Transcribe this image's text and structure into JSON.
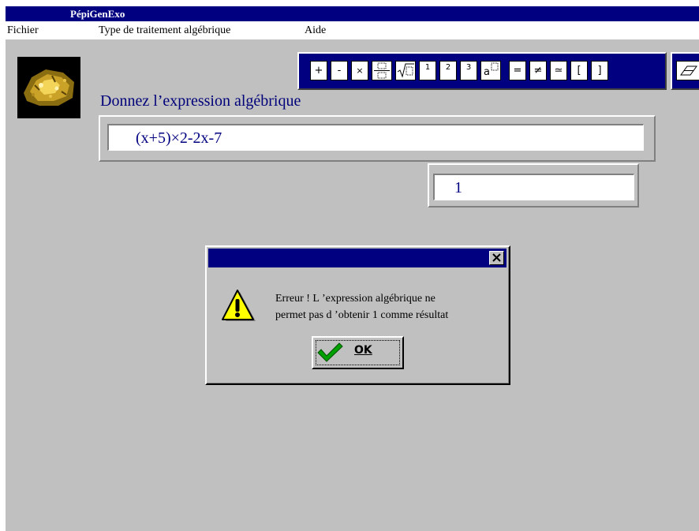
{
  "window": {
    "title": "PépiGenExo"
  },
  "menu": {
    "items": [
      "Fichier",
      "Type de traitement algébrique",
      "Aide"
    ]
  },
  "toolbar": {
    "buttons": [
      {
        "icon": "plus-icon",
        "label": "+"
      },
      {
        "icon": "minus-icon",
        "label": "-"
      },
      {
        "icon": "times-icon",
        "label": "×"
      },
      {
        "icon": "fraction-icon",
        "label": ""
      },
      {
        "icon": "sqrt-icon",
        "label": ""
      },
      {
        "icon": "superscript-1-icon",
        "label": "1"
      },
      {
        "icon": "superscript-2-icon",
        "label": "2"
      },
      {
        "icon": "superscript-3-icon",
        "label": "3"
      },
      {
        "icon": "exponent-icon",
        "label": "a"
      },
      {
        "icon": "equals-icon",
        "label": "="
      },
      {
        "icon": "not-equal-icon",
        "label": "≠"
      },
      {
        "icon": "approx-icon",
        "label": "≃"
      },
      {
        "icon": "left-bracket-icon",
        "label": "["
      },
      {
        "icon": "right-bracket-icon",
        "label": "]"
      },
      {
        "icon": "eraser-icon",
        "label": ""
      }
    ]
  },
  "main": {
    "prompt": "Donnez l’expression algébrique",
    "expression": "(x+5)×2-2x-7",
    "result": "1"
  },
  "dialog": {
    "icon": "warning-icon",
    "message_line1": "Erreur ! L ’expression algébrique ne",
    "message_line2": "permet pas d ’obtenir 1 comme résultat",
    "ok_label": "OK",
    "ok_icon": "checkmark-icon"
  },
  "colors": {
    "titlebar": "#000080",
    "window_bg": "#c0c0c0",
    "prompt_text": "#00007a",
    "warning_yellow": "#ffff00",
    "check_green": "#00a000"
  }
}
